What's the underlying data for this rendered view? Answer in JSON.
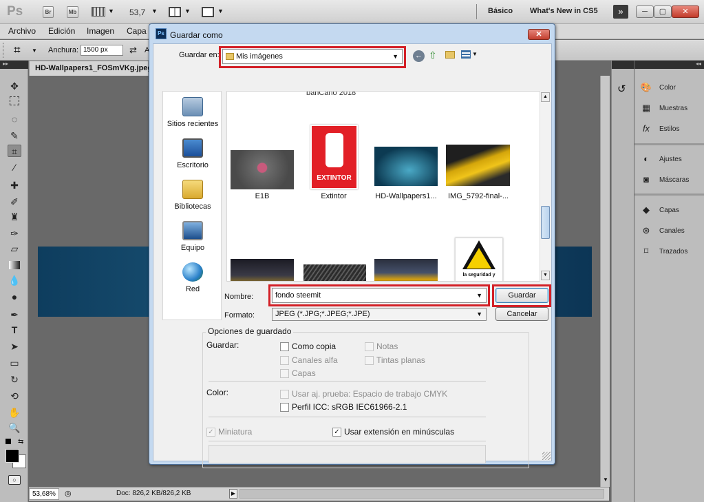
{
  "app": {
    "logo": "Ps",
    "bridge_btn": "Br",
    "minibridge_btn": "Mb",
    "zoom": "53,7",
    "workspaces": {
      "basic": "Básico",
      "whats_new": "What's New in CS5"
    },
    "win_controls": {
      "min": "─",
      "restore": "▢",
      "close": "✕"
    }
  },
  "menu": [
    "Archivo",
    "Edición",
    "Imagen",
    "Capa"
  ],
  "options": {
    "width_label": "Anchura:",
    "width_value": "1500 px",
    "height_label": "A"
  },
  "document": {
    "tab_title": "HD-Wallpapers1_FOSmVKg.jpeg",
    "zoom_status": "53,68%",
    "doc_info": "Doc: 826,2 KB/826,2 KB"
  },
  "panels": {
    "group1": [
      {
        "label": "Color",
        "icon": "color-palette-icon"
      },
      {
        "label": "Muestras",
        "icon": "swatches-grid-icon"
      },
      {
        "label": "Estilos",
        "icon": "styles-fx-icon"
      }
    ],
    "group2": [
      {
        "label": "Ajustes",
        "icon": "adjustments-icon"
      },
      {
        "label": "Máscaras",
        "icon": "masks-icon"
      }
    ],
    "group3": [
      {
        "label": "Capas",
        "icon": "layers-icon"
      },
      {
        "label": "Canales",
        "icon": "channels-icon"
      },
      {
        "label": "Trazados",
        "icon": "paths-icon"
      }
    ]
  },
  "dialog": {
    "title": "Guardar como",
    "save_in_label": "Guardar en:",
    "save_in_value": "Mis imágenes",
    "places": [
      {
        "label": "Sitios recientes",
        "icon": "recent-places-icon"
      },
      {
        "label": "Escritorio",
        "icon": "desktop-icon"
      },
      {
        "label": "Bibliotecas",
        "icon": "libraries-icon"
      },
      {
        "label": "Equipo",
        "icon": "computer-icon"
      },
      {
        "label": "Red",
        "icon": "network-icon"
      }
    ],
    "files_top_partial": "banCano 2018",
    "files": [
      "E1B",
      "Extintor",
      "HD-Wallpapers1...",
      "IMG_5792-final-..."
    ],
    "extintor_text": "EXTINTOR",
    "seguridad_text": "la seguridad y",
    "name_label": "Nombre:",
    "name_value": "fondo steemit",
    "format_label": "Formato:",
    "format_value": "JPEG (*.JPG;*.JPEG;*.JPE)",
    "save_button": "Guardar",
    "cancel_button": "Cancelar",
    "options_title": "Opciones de guardado",
    "save_group_label": "Guardar:",
    "options": {
      "as_copy": "Como copia",
      "notes": "Notas",
      "alpha_channels": "Canales alfa",
      "spot_colors": "Tintas planas",
      "layers": "Capas"
    },
    "color_label": "Color:",
    "proof_setup": "Usar aj. prueba: Espacio de trabajo CMYK",
    "icc_profile": "Perfil ICC: sRGB IEC61966-2.1",
    "thumbnail": "Miniatura",
    "lowercase_ext": "Usar extensión en minúsculas"
  }
}
